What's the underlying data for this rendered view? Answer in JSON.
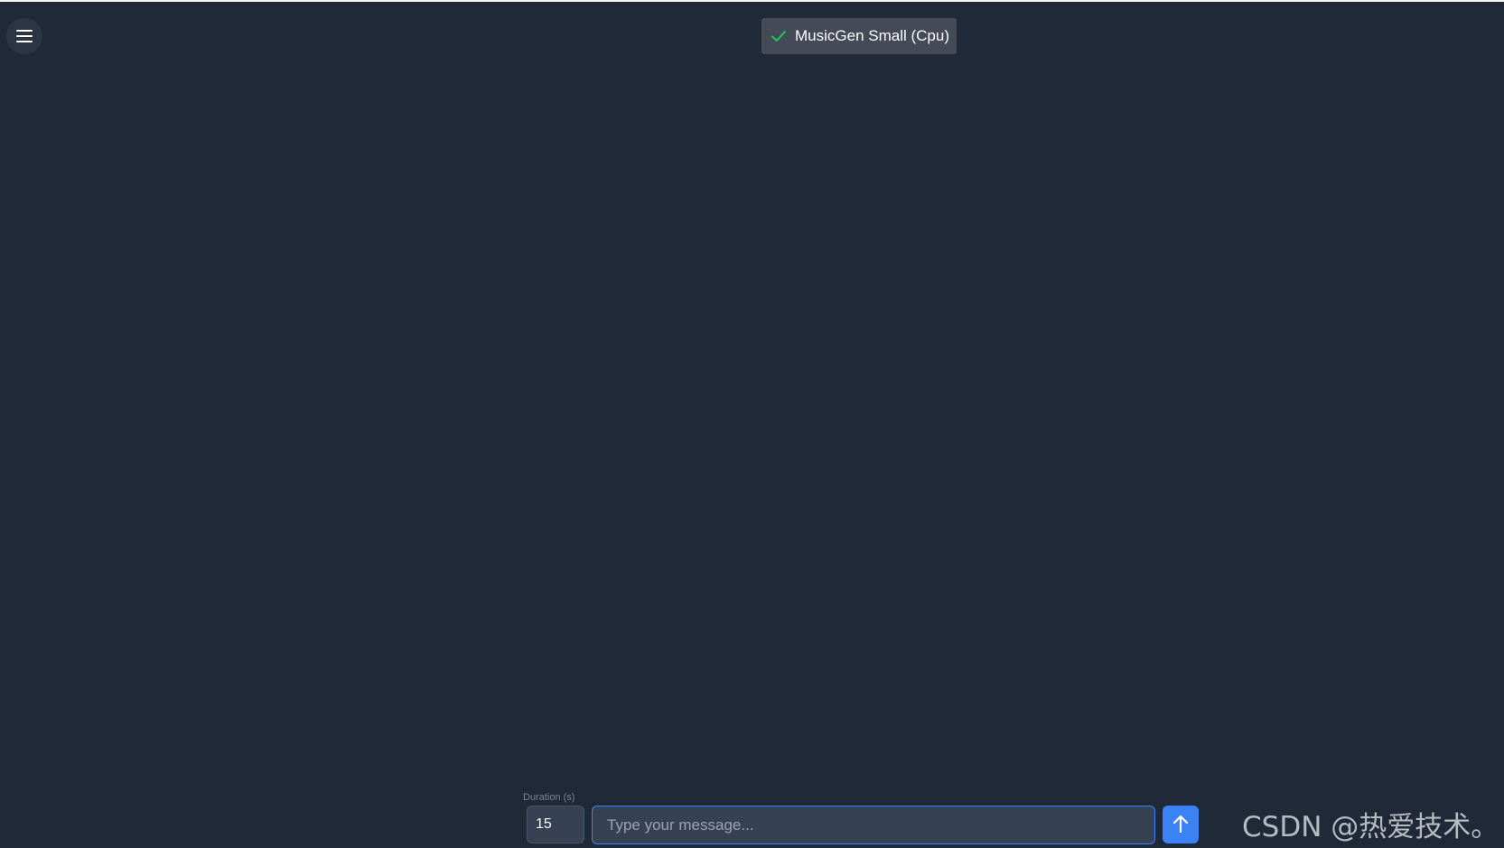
{
  "header": {
    "menu_icon": "hamburger-menu-icon",
    "model": {
      "status_icon": "check-icon",
      "status_color": "#22c55e",
      "label": "MusicGen Small (Cpu)"
    }
  },
  "composer": {
    "duration": {
      "label": "Duration (s)",
      "value": "15"
    },
    "message": {
      "placeholder": "Type your message...",
      "value": ""
    },
    "send_icon": "arrow-up-icon",
    "accent_color": "#3b82f6"
  },
  "watermark": {
    "text": "CSDN @热爱技术。"
  }
}
